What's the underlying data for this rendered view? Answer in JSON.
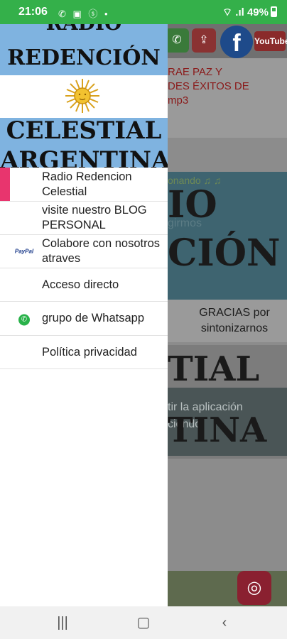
{
  "status_bar": {
    "time": "21:06",
    "icons": "✆ ▣ ⓢ •",
    "signal": "⌔ .ıl",
    "battery": "49%"
  },
  "drawer": {
    "header": {
      "line1": "RADIO",
      "line2": "REDENCIÓN",
      "line3": "CELESTIAL",
      "line4": "ARGENTINA"
    },
    "items": [
      {
        "label": "Radio Redencion Celestial",
        "icon": "",
        "active": true
      },
      {
        "label": "visite nuestro BLOG PERSONAL",
        "icon": ""
      },
      {
        "label": "Colabore con nosotros atraves",
        "icon": "paypal-icon",
        "icon_text": "PayPal"
      },
      {
        "label": "Acceso directo",
        "icon": ""
      },
      {
        "label": "grupo de Whatsapp",
        "icon": "whatsapp-icon"
      },
      {
        "label": "Política privacidad",
        "icon": ""
      }
    ]
  },
  "background": {
    "news": "RAE PAZ Y\nDES ÉXITOS DE\nmp3",
    "banner_small": "onando ♫ ♫",
    "banner_big1": "IO",
    "banner_small2": "girmos",
    "banner_big2": "CIÓN",
    "thanks": "GRACIAS por sintonizarnos",
    "banner_big3": "TIAL",
    "dialog_text": "tir la aplicación\nciendo.",
    "banner_big4": "TINA",
    "facebook": "f",
    "youtube": "YouTube"
  },
  "colors": {
    "status_bar": "#34b04a",
    "flag_blue": "#7fb3e0",
    "active_indicator": "#e8356e"
  }
}
